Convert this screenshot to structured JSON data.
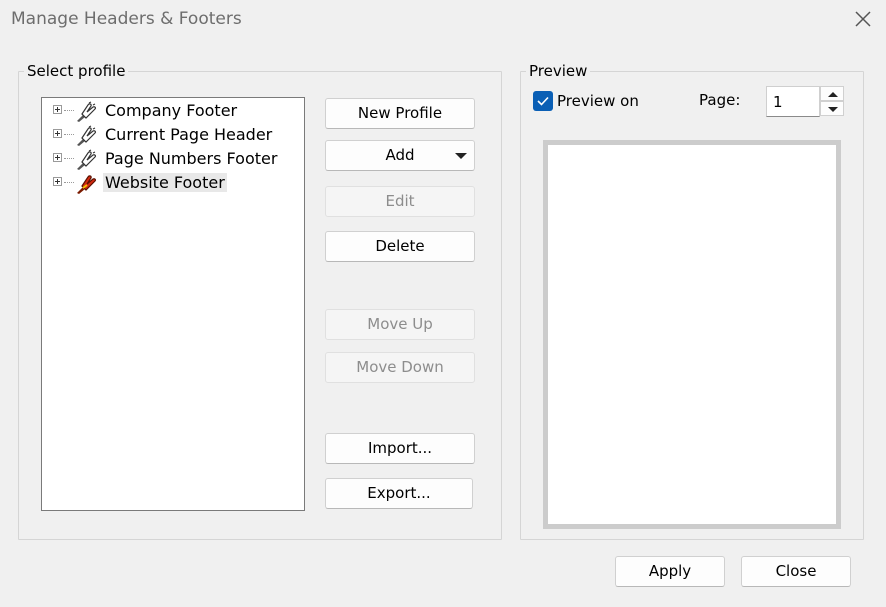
{
  "window": {
    "title": "Manage Headers & Footers",
    "close_icon": "close-icon"
  },
  "profile_group": {
    "legend": "Select profile",
    "tree_items": [
      {
        "label": "Company Footer",
        "icon": "profile-hand-icon",
        "selected": false
      },
      {
        "label": "Current Page Header",
        "icon": "profile-hand-icon",
        "selected": false
      },
      {
        "label": "Page Numbers Footer",
        "icon": "profile-hand-icon",
        "selected": false
      },
      {
        "label": "Website Footer",
        "icon": "profile-red-hand-icon",
        "selected": true
      }
    ],
    "buttons": {
      "new_profile": "New Profile",
      "add": "Add",
      "edit": "Edit",
      "delete": "Delete",
      "move_up": "Move Up",
      "move_down": "Move Down",
      "import": "Import...",
      "export": "Export..."
    },
    "disabled": [
      "Edit",
      "Move Up",
      "Move Down"
    ]
  },
  "preview_group": {
    "legend": "Preview",
    "preview_on_label": "Preview on",
    "preview_on_checked": true,
    "page_label": "Page:",
    "page_value": "1"
  },
  "footer": {
    "apply": "Apply",
    "close": "Close"
  },
  "colors": {
    "background": "#f0f0f0",
    "checkbox_accent": "#0a5fb5",
    "disabled_text": "#8d8d8d",
    "selection": "#e8e8e8"
  }
}
